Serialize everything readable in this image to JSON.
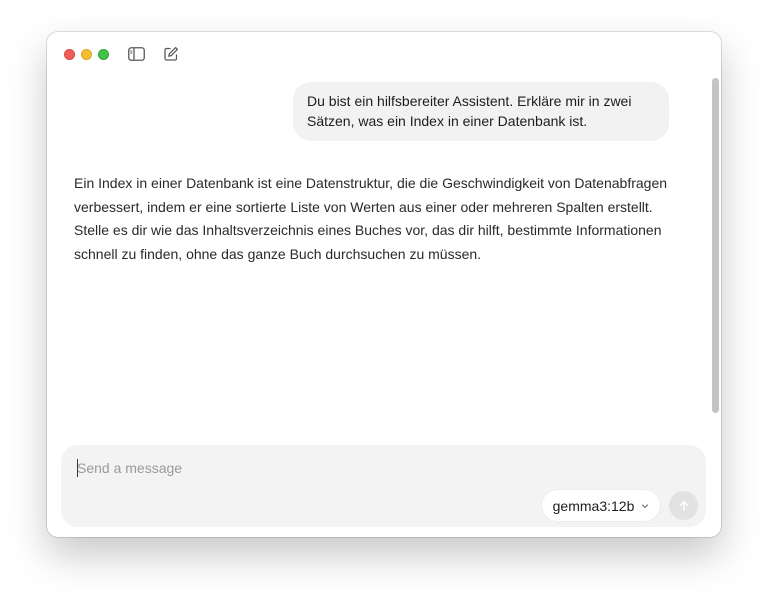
{
  "window": {
    "icons": {
      "sidebar_toggle": "sidebar-icon",
      "new_chat": "compose-icon"
    },
    "traffic_lights": {
      "close": "#ee5f57",
      "minimize": "#f6be2f",
      "maximize": "#41c345"
    }
  },
  "conversation": {
    "user_message": "Du bist ein hilfsbereiter Assistent. Erkläre mir in zwei Sätzen, was ein Index in einer Datenbank ist.",
    "assistant_message": "Ein Index in einer Datenbank ist eine Datenstruktur, die die Geschwindigkeit von Datenabfragen verbessert, indem er eine sortierte Liste von Werten aus einer oder mehreren Spalten erstellt. Stelle es dir wie das Inhaltsverzeichnis eines Buches vor, das dir hilft, bestimmte Informationen schnell zu finden, ohne das ganze Buch durchsuchen zu müssen."
  },
  "composer": {
    "placeholder": "Send a message",
    "value": "",
    "model": "gemma3:12b",
    "send_icon": "arrow-up-icon"
  },
  "colors": {
    "bubble_bg": "#f2f2f2",
    "composer_bg": "#f3f3f3",
    "send_disabled": "#e2e2e2"
  }
}
